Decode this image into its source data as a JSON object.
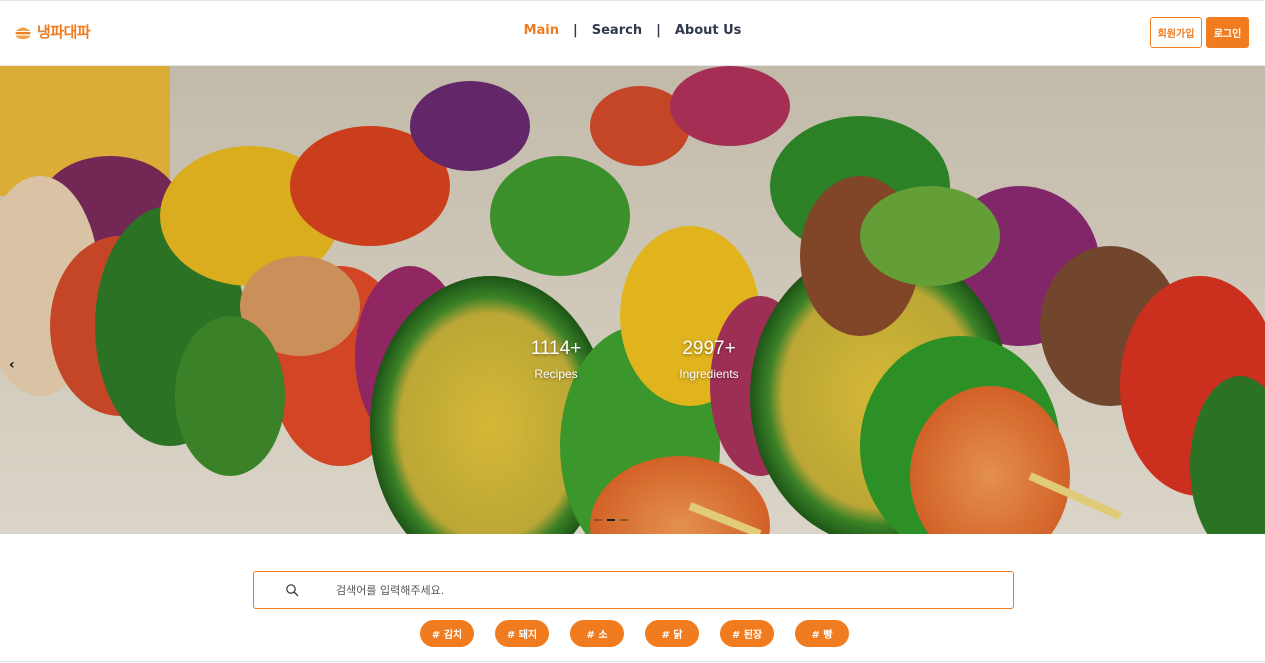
{
  "header": {
    "logo_text": "냉파대파",
    "nav": [
      {
        "label": "Main",
        "active": true
      },
      {
        "label": "Search",
        "active": false
      },
      {
        "label": "About Us",
        "active": false
      }
    ],
    "nav_separator": "|",
    "signup_label": "회원가입",
    "login_label": "로그인"
  },
  "hero": {
    "prev_arrow": "‹",
    "stats": [
      {
        "value": "1114+",
        "label": "Recipes"
      },
      {
        "value": "2997+",
        "label": "Ingredients"
      }
    ],
    "slide_count": 3,
    "active_slide": 1
  },
  "search": {
    "placeholder": "검색어를 입력해주세요.",
    "value": ""
  },
  "tags": [
    "# 김치",
    "# 돼지",
    "# 소",
    "# 닭",
    "# 된장",
    "# 빵"
  ],
  "colors": {
    "accent": "#f07c1f",
    "nav_text": "#2f3a4a"
  },
  "icons": {
    "logo": "burger-icon",
    "search": "search-icon",
    "prev": "chevron-left-icon"
  }
}
